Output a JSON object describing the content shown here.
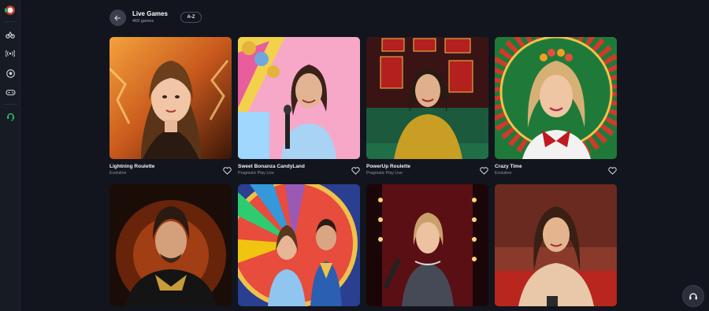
{
  "header": {
    "title": "Live Games",
    "count": "469 games",
    "sort_label": "A-Z"
  },
  "sidebar": {
    "items": [
      {
        "icon": "logo-icon"
      },
      {
        "icon": "sports-icon"
      },
      {
        "icon": "live-broadcast-icon"
      },
      {
        "icon": "football-icon"
      },
      {
        "icon": "gamepad-icon"
      },
      {
        "icon": "support-agent-icon"
      }
    ]
  },
  "games": [
    {
      "name": "Lightning Roulette",
      "provider": "Evolution"
    },
    {
      "name": "Sweet Bonanza CandyLand",
      "provider": "Pragmatic Play Live"
    },
    {
      "name": "PowerUp Roulette",
      "provider": "Pragmatic Play Live"
    },
    {
      "name": "Crazy Time",
      "provider": "Evolution"
    },
    {
      "name": "",
      "provider": ""
    },
    {
      "name": "",
      "provider": ""
    },
    {
      "name": "",
      "provider": ""
    },
    {
      "name": "",
      "provider": ""
    }
  ],
  "colors": {
    "background": "#12151d",
    "sidebar": "#171b24",
    "accent_green": "#2ecc71"
  }
}
